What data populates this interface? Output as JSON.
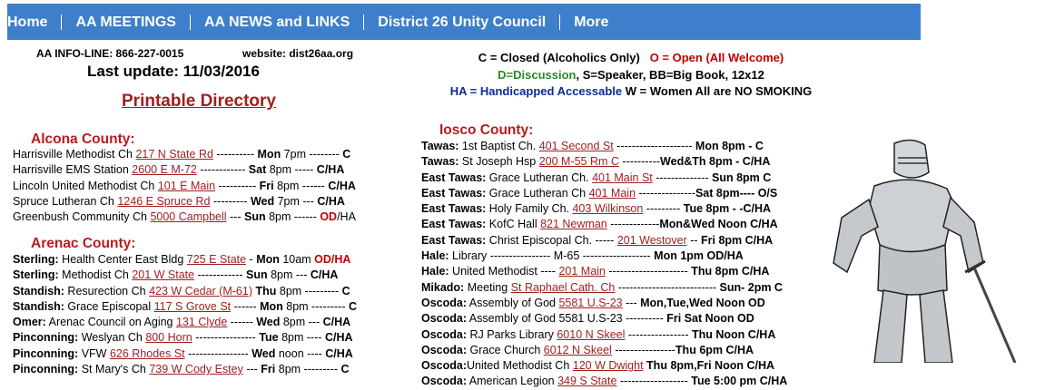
{
  "nav": [
    "Home",
    "AA MEETINGS",
    "AA NEWS and LINKS",
    "District 26 Unity Council",
    "More"
  ],
  "info_line": "AA INFO-LINE: 866-227-0015",
  "website": "website: dist26aa.org",
  "last_update": "Last update: 11/03/2016",
  "printable": "Printable Directory",
  "legend": {
    "closed": "C = Closed (Alcoholics Only)",
    "open": "O = Open (All Welcome)",
    "discussion": "D=Discussion",
    "speaker_etc": ", S=Speaker, BB=Big Book, 12x12",
    "handicapped": "HA = Handicapped Accessable",
    "women_smoking": " W = Women   All are NO SMOKING"
  },
  "alcona": {
    "title": "Alcona County:",
    "rows": [
      [
        "Harrisville Methodist Ch ",
        "217 N State Rd",
        " ---------- ",
        "Mon",
        " 7pm  -------- ",
        "C",
        ""
      ],
      [
        "Harrisville EMS Station ",
        "2600 E M-72",
        " ------------ ",
        "Sat",
        " 8pm  -----  ",
        "C/HA",
        ""
      ],
      [
        "Lincoln United Methodist Ch ",
        "101 E Main",
        " ---------- ",
        "Fri",
        " 8pm ------ ",
        "C/HA",
        ""
      ],
      [
        "Spruce Lutheran Ch ",
        "1246 E Spruce Rd",
        " --------- ",
        "Wed",
        " 7pm --- ",
        "C/HA",
        ""
      ],
      [
        "Greenbush Community Ch ",
        "5000 Campbell",
        " --- ",
        "Sun",
        " 8pm ------ ",
        "OD",
        "/HA"
      ]
    ]
  },
  "arenac": {
    "title": "Arenac County:",
    "rows": [
      [
        "Sterling:",
        " Health Center East Bldg ",
        "725 E State",
        " - ",
        "Mon",
        " 10am  ",
        "OD/HA"
      ],
      [
        "Sterling:",
        " Methodist Ch ",
        "201 W State",
        " ------------ ",
        "Sun",
        " 8pm  --- ",
        "C/HA"
      ],
      [
        "Standish:",
        " Resurection Ch ",
        "423 W Cedar (M-61)",
        "  ",
        "Thu",
        " 8pm --------- ",
        "C"
      ],
      [
        "Standish:",
        " Grace Episcopal ",
        "117 S Grove St",
        " ------ ",
        "Mon",
        " 8pm --------- ",
        "C"
      ],
      [
        "Omer:",
        " Arenac Council on Aging ",
        "131 Clyde",
        " ------ ",
        "Wed",
        " 8pm --- ",
        "C/HA"
      ],
      [
        "Pinconning:",
        " Weslyan Ch ",
        "800 Horn",
        " ---------------- ",
        "Tue",
        " 8pm ---- ",
        "C/HA"
      ],
      [
        "Pinconning:",
        " VFW ",
        "626 Rhodes St",
        " ---------------- ",
        "Wed",
        " noon ---- ",
        "C/HA"
      ],
      [
        "Pinconning:",
        " St Mary's Ch ",
        "739 W Cody Estey",
        " --- ",
        "Fri",
        " 8pm --------- ",
        "C"
      ]
    ]
  },
  "iosco": {
    "title": "Iosco County:",
    "rows": [
      [
        "Tawas:",
        " 1st Baptist Ch. ",
        "401 Second St",
        "  -------------------- ",
        "Mon 8pm",
        "  - C",
        ""
      ],
      [
        "Tawas:",
        " St Joseph Hsp ",
        "200 M-55 Rm C",
        " ----------",
        "Wed&Th",
        " 8pm - C/HA",
        ""
      ],
      [
        "East Tawas:",
        " Grace Lutheran Ch. ",
        "401 Main St",
        " -------------- ",
        "Sun",
        " 8pm C",
        ""
      ],
      [
        "East Tawas:",
        " Grace Lutheran Ch ",
        "401 Main",
        " ---------------",
        "Sat",
        " 8pm---- O/S",
        ""
      ],
      [
        "East Tawas:",
        " Holy Family Ch. ",
        "403 Wilkinson",
        " --------- ",
        "Tue",
        " 8pm - -C/HA",
        ""
      ],
      [
        "East Tawas:",
        " KofC Hall ",
        "821 Newman",
        " -------------",
        "Mon&Wed Noon C/HA",
        "",
        ""
      ],
      [
        "East Tawas:",
        " Christ Episcopal Ch. ----- ",
        "201 Westover",
        " -- ",
        "Fri",
        " 8pm C/HA",
        ""
      ],
      [
        "Hale:",
        " Library ---------------- M-65 ------------------ ",
        "",
        "",
        "Mon 1pm OD/HA",
        "",
        ""
      ],
      [
        "Hale:",
        " United Methodist ---- ",
        "201 Main",
        " --------------------- ",
        "Thu",
        " 8pm C/HA",
        ""
      ],
      [
        "Mikado:",
        " Meeting ",
        "St Raphael Cath. Ch",
        " -------------------------- ",
        "Sun",
        "- 2pm C",
        ""
      ],
      [
        "Oscoda:",
        " Assembly of God ",
        "5581  U.S-23",
        " ---  ",
        "Mon,Tue,Wed",
        " Noon OD",
        ""
      ],
      [
        "Oscoda:",
        " Assembly of God 5581  U.S-23 ---------- ",
        "",
        "",
        "Fri Sat",
        " Noon OD",
        ""
      ],
      [
        "Oscoda:",
        " RJ Parks Library ",
        "6010 N Skeel",
        " ---------------- ",
        "Thu",
        " Noon C/HA",
        ""
      ],
      [
        "Oscoda:",
        " Grace Church ",
        "6012 N Skeel",
        " ----------------",
        "Thu",
        " 6pm C/HA",
        ""
      ],
      [
        "Oscoda:",
        "United Methodist Ch ",
        "120 W Dwight",
        " ",
        "Thu",
        " 8pm,Fri Noon C/HA",
        ""
      ],
      [
        "Oscoda:",
        " American Legion ",
        "349 S State",
        " ------------------ ",
        "Tue",
        " 5:00 pm C/HA",
        ""
      ]
    ]
  }
}
